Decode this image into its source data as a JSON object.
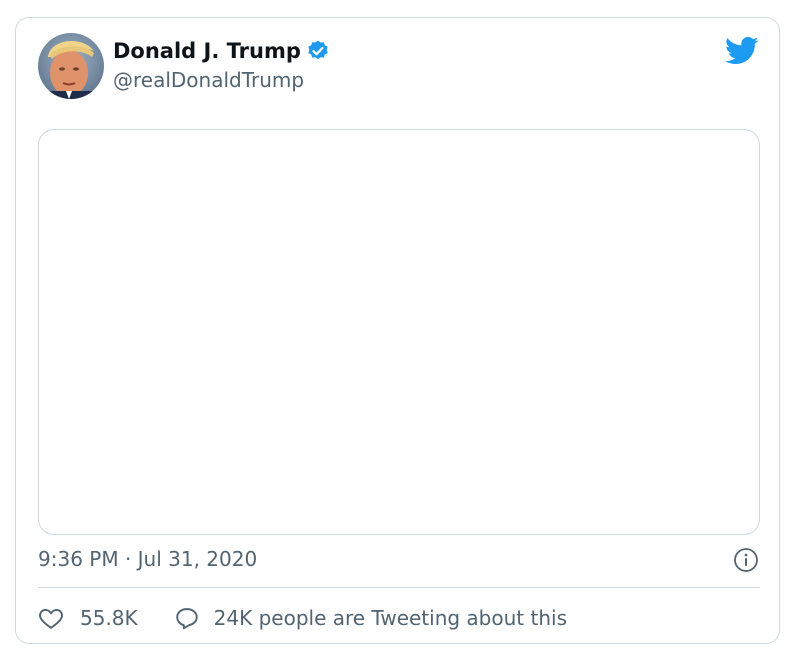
{
  "tweet": {
    "display_name": "Donald J. Trump",
    "handle": "@realDonaldTrump",
    "verified": true,
    "timestamp": "9:36 PM · Jul 31, 2020",
    "like_count": "55.8K",
    "conversation_text": "24K people are Tweeting about this"
  },
  "icons": {
    "brand": "twitter-bird-icon",
    "verified": "verified-badge-icon",
    "info": "info-icon",
    "like": "heart-icon",
    "reply": "speech-bubble-icon"
  },
  "colors": {
    "brand_blue": "#1d9bf0",
    "text_primary": "#0f1419",
    "text_secondary": "#536471",
    "border": "#cfd9de"
  }
}
